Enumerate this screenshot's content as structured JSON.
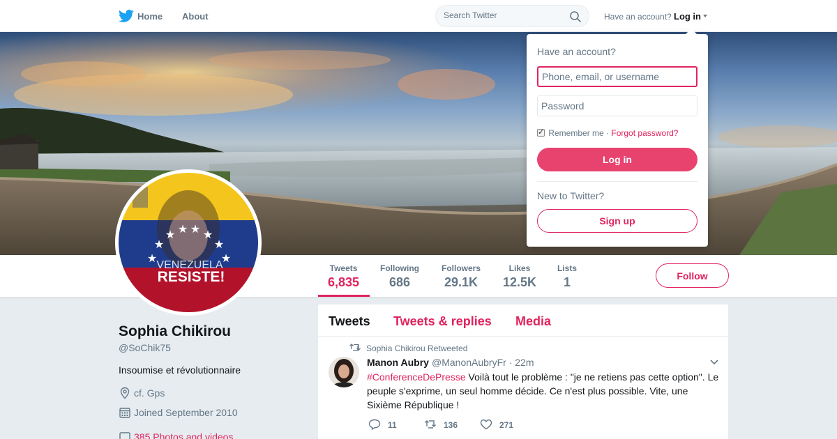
{
  "nav": {
    "home_label": "Home",
    "about_label": "About",
    "home_icon": "twitter-bird-icon",
    "search_placeholder": "Search Twitter",
    "have_account_text": "Have an account?",
    "login_label": "Log in"
  },
  "profile": {
    "name": "Sophia Chikirou",
    "handle": "@SoChik75",
    "bio": "Insoumise et révolutionnaire",
    "location": "cf. Gps",
    "joined": "Joined September 2010",
    "media_link": "385 Photos and videos",
    "avatar_text_1": "VENEZUELA",
    "avatar_text_2": "RESISTE!"
  },
  "stats": [
    {
      "label": "Tweets",
      "value": "6,835"
    },
    {
      "label": "Following",
      "value": "686"
    },
    {
      "label": "Followers",
      "value": "29.1K"
    },
    {
      "label": "Likes",
      "value": "12.5K"
    },
    {
      "label": "Lists",
      "value": "1"
    }
  ],
  "follow_label": "Follow",
  "timeline": {
    "tabs": [
      "Tweets",
      "Tweets & replies",
      "Media"
    ],
    "tweet": {
      "retweet_context": "Sophia Chikirou Retweeted",
      "author_name": "Manon Aubry",
      "author_handle": "@ManonAubryFr · 22m",
      "hashtag": "#ConferenceDePresse",
      "text": " Voilà tout le problème : \"je ne retiens pas cette option\". Le peuple s'exprime, un seul homme décide. Ce n'est plus possible. Vite, une Sixième République !",
      "replies": "11",
      "retweets": "136",
      "likes": "271"
    }
  },
  "login_dropdown": {
    "title": "Have an account?",
    "username_placeholder": "Phone, email, or username",
    "password_placeholder": "Password",
    "remember_label": "Remember me",
    "separator": " · ",
    "forgot_label": "Forgot password?",
    "login_button": "Log in",
    "new_prompt": "New to Twitter?",
    "signup_button": "Sign up"
  },
  "colors": {
    "accent": "#e0245e",
    "login_button": "#e8426f",
    "muted": "#657786",
    "twitter_blue": "#1da1f2"
  }
}
